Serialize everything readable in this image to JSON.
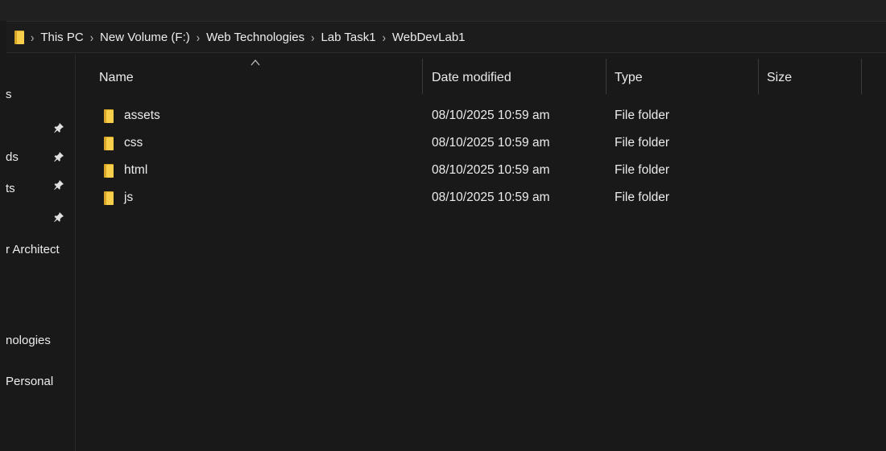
{
  "breadcrumb": {
    "items": [
      "This PC",
      "New Volume (F:)",
      "Web Technologies",
      "Lab Task1",
      "WebDevLab1"
    ],
    "separator": "›"
  },
  "sidebar": {
    "items": [
      {
        "label": "s",
        "pinned": false
      },
      {
        "label": "",
        "pinned": true
      },
      {
        "label": "ds",
        "pinned": true
      },
      {
        "label": "ts",
        "pinned": true
      },
      {
        "label": "",
        "pinned": true
      },
      {
        "label": "r Architect",
        "pinned": false
      },
      {
        "label": "nologies",
        "pinned": false
      },
      {
        "label": "Personal",
        "pinned": false
      }
    ]
  },
  "columns": {
    "name": "Name",
    "date": "Date modified",
    "type": "Type",
    "size": "Size"
  },
  "files": [
    {
      "name": "assets",
      "date": "08/10/2025 10:59 am",
      "type": "File folder",
      "size": "",
      "icon": "folder-icon"
    },
    {
      "name": "css",
      "date": "08/10/2025 10:59 am",
      "type": "File folder",
      "size": "",
      "icon": "folder-icon"
    },
    {
      "name": "html",
      "date": "08/10/2025 10:59 am",
      "type": "File folder",
      "size": "",
      "icon": "folder-icon"
    },
    {
      "name": "js",
      "date": "08/10/2025 10:59 am",
      "type": "File folder",
      "size": "",
      "icon": "folder-icon"
    }
  ],
  "colors": {
    "background": "#191919",
    "text": "#ececec",
    "folder_front": "#f8ce4a",
    "folder_back": "#d9a728"
  }
}
